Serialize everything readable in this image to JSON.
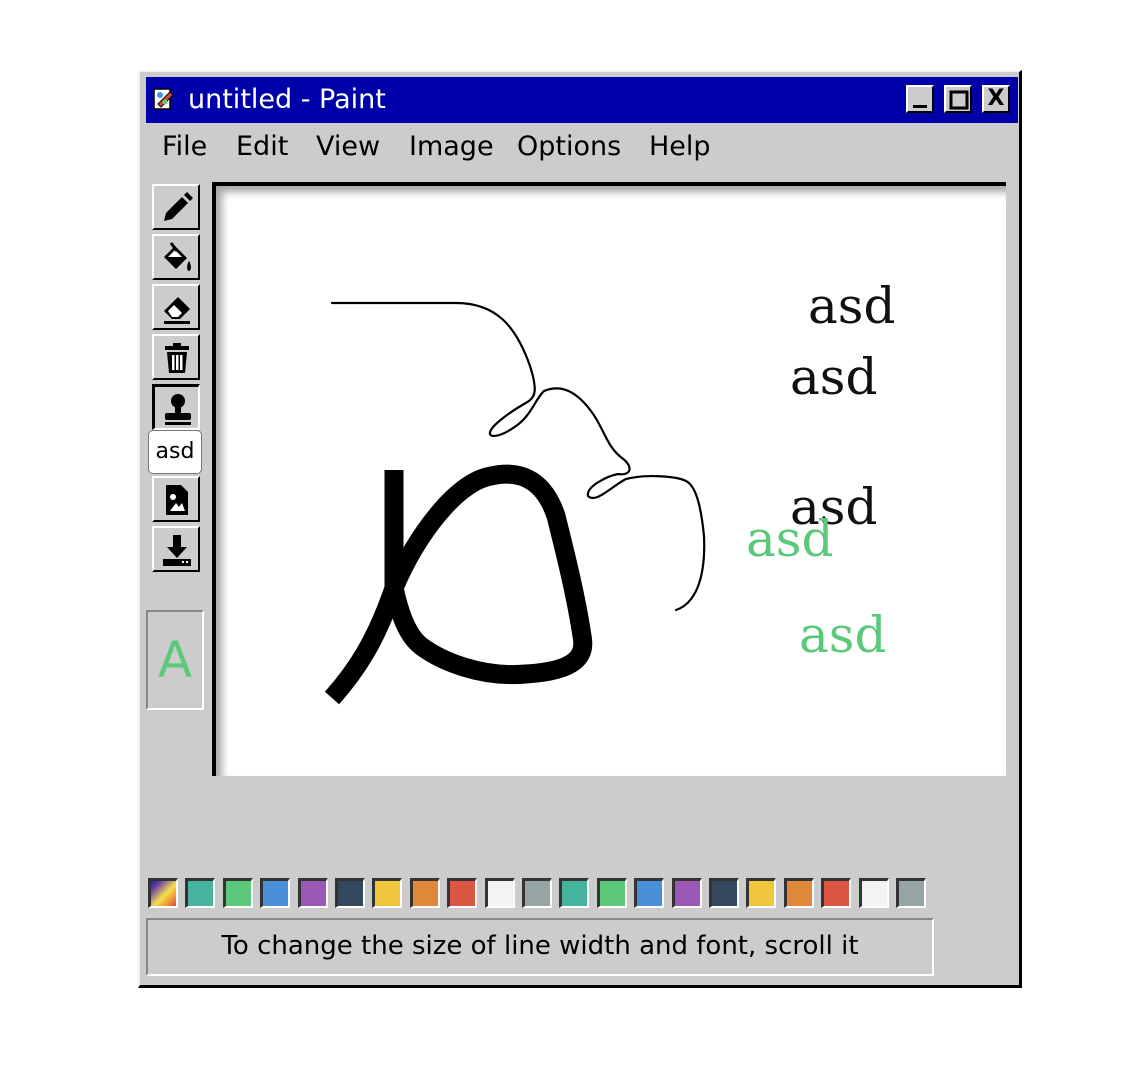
{
  "window": {
    "title": "untitled - Paint",
    "app_icon": "paint-app-icon"
  },
  "title_buttons": [
    {
      "name": "minimize-button",
      "icon": "minimize-icon"
    },
    {
      "name": "maximize-button",
      "icon": "maximize-icon"
    },
    {
      "name": "close-button",
      "icon": "close-x-icon",
      "label": "X"
    }
  ],
  "menu": [
    {
      "label": "File"
    },
    {
      "label": "Edit"
    },
    {
      "label": "View"
    },
    {
      "label": "Image"
    },
    {
      "label": "Options"
    },
    {
      "label": "Help"
    }
  ],
  "tools": [
    {
      "name": "pencil-tool",
      "icon": "pencil-icon"
    },
    {
      "name": "fill-tool",
      "icon": "paint-bucket-icon"
    },
    {
      "name": "eraser-tool",
      "icon": "eraser-icon"
    },
    {
      "name": "clear-tool",
      "icon": "trash-icon"
    },
    {
      "name": "stamp-tool",
      "icon": "stamp-icon",
      "active": true
    },
    {
      "name": "open-image-tool",
      "icon": "image-file-icon"
    },
    {
      "name": "save-tool",
      "icon": "download-icon"
    }
  ],
  "tooltip": {
    "text": "asd"
  },
  "current_color": {
    "glyph": "A",
    "color": "#5cc97a"
  },
  "canvas": {
    "stamps": [
      {
        "text": "asd",
        "color": "#111111"
      },
      {
        "text": "asd",
        "color": "#111111"
      },
      {
        "text": "asd",
        "color": "#111111"
      },
      {
        "text": "asd",
        "color": "#5cc97a"
      },
      {
        "text": "asd",
        "color": "#5cc97a"
      }
    ]
  },
  "palette": {
    "first": "gradient",
    "colors": [
      "#45b39d",
      "#5cc97a",
      "#4a90d9",
      "#9b59b6",
      "#34495e",
      "#f0c73c",
      "#e0883a",
      "#dc5644",
      "#f2f4f4",
      "#95a5a6",
      "#45b39d",
      "#5cc97a",
      "#4a90d9",
      "#9b59b6",
      "#34495e",
      "#f0c73c",
      "#e0883a",
      "#dc5644",
      "#f2f4f4",
      "#95a5a6"
    ]
  },
  "status": {
    "text": "To change the size of line width and font, scroll it"
  }
}
